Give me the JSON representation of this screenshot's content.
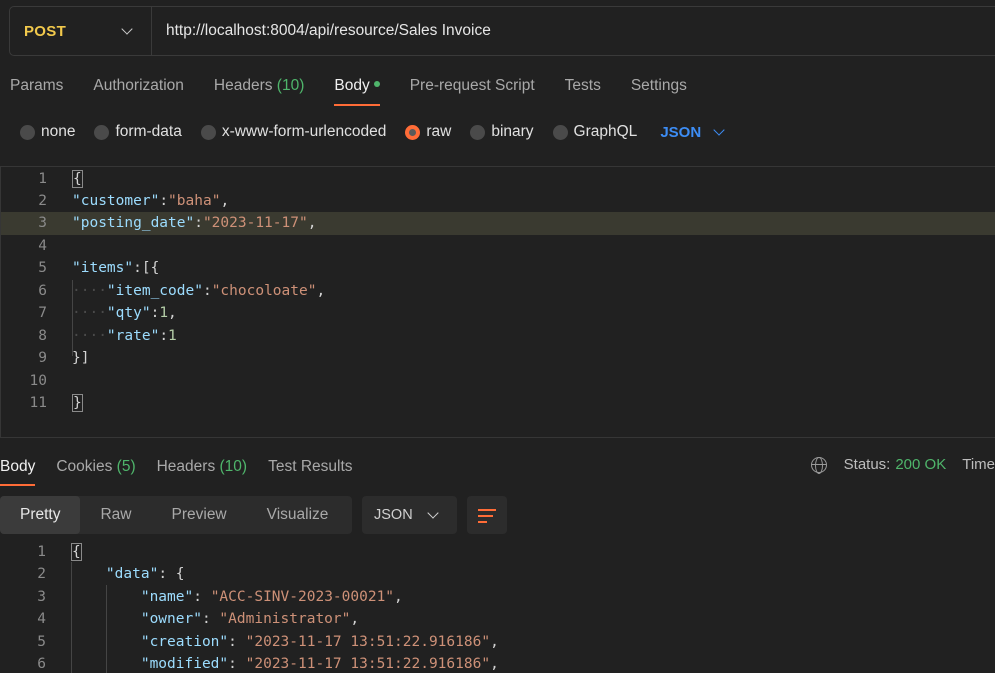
{
  "request": {
    "method": "POST",
    "url": "http://localhost:8004/api/resource/Sales Invoice"
  },
  "request_tabs": [
    {
      "label": "Params",
      "count": ""
    },
    {
      "label": "Authorization",
      "count": ""
    },
    {
      "label": "Headers ",
      "count": "(10)"
    },
    {
      "label": "Body",
      "count": ""
    },
    {
      "label": "Pre-request Script",
      "count": ""
    },
    {
      "label": "Tests",
      "count": ""
    },
    {
      "label": "Settings",
      "count": ""
    }
  ],
  "body_types": [
    "none",
    "form-data",
    "x-www-form-urlencoded",
    "raw",
    "binary",
    "GraphQL"
  ],
  "body_format": "JSON",
  "request_body_lines": [
    {
      "n": "1"
    },
    {
      "n": "2"
    },
    {
      "n": "3"
    },
    {
      "n": "4"
    },
    {
      "n": "5"
    },
    {
      "n": "6"
    },
    {
      "n": "7"
    },
    {
      "n": "8"
    },
    {
      "n": "9"
    },
    {
      "n": "10"
    },
    {
      "n": "11"
    }
  ],
  "request_body": {
    "customer_key": "\"customer\"",
    "customer_val": "\"baha\"",
    "posting_date_key": "\"posting_date\"",
    "posting_date_val": "\"2023-11-17\"",
    "items_key": "\"items\"",
    "item_code_key": "\"item_code\"",
    "item_code_val": "\"chocoloate\"",
    "qty_key": "\"qty\"",
    "qty_val": "1",
    "rate_key": "\"rate\"",
    "rate_val": "1"
  },
  "response_tabs": [
    {
      "label": "Body",
      "count": ""
    },
    {
      "label": "Cookies ",
      "count": "(5)"
    },
    {
      "label": "Headers ",
      "count": "(10)"
    },
    {
      "label": "Test Results",
      "count": ""
    }
  ],
  "status": {
    "label": "Status:",
    "value": "200 OK",
    "time_label": "Time"
  },
  "views": [
    "Pretty",
    "Raw",
    "Preview",
    "Visualize"
  ],
  "response_format": "JSON",
  "response_body": {
    "data_key": "\"data\"",
    "name_key": "\"name\"",
    "name_val": "\"ACC-SINV-2023-00021\"",
    "owner_key": "\"owner\"",
    "owner_val": "\"Administrator\"",
    "creation_key": "\"creation\"",
    "creation_val": "\"2023-11-17 13:51:22.916186\"",
    "modified_key": "\"modified\"",
    "modified_val": "\"2023-11-17 13:51:22.916186\""
  },
  "colors": {
    "accent": "#ff6c37",
    "method": "#f2c94c",
    "success": "#4fb56b",
    "link": "#3d8df5"
  }
}
